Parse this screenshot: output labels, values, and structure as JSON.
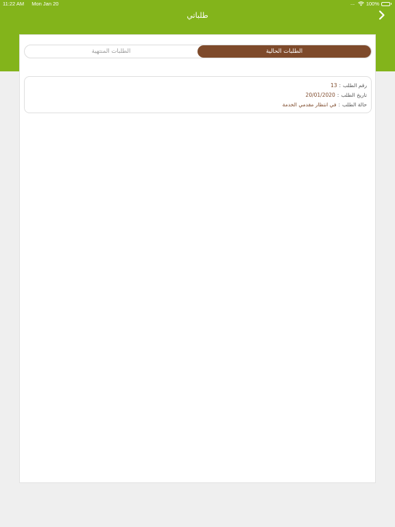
{
  "status_bar": {
    "time": "11:22 AM",
    "date": "Mon Jan 20",
    "battery": "100%",
    "signal_dots": "....."
  },
  "header": {
    "title": "طلباتي",
    "back_icon": "chevron-right-icon",
    "color": "#83b41b"
  },
  "tabs": {
    "current_label": "الطلبات الحالية",
    "finished_label": "الطلبات المنتهية",
    "active": "current",
    "active_color": "#7e4a2b"
  },
  "orders": [
    {
      "number_label": "رقم الطلب",
      "number_value": "13",
      "date_label": "تاريخ الطلب",
      "date_value": "20/01/2020",
      "status_label": "حالة الطلب",
      "status_value": "في انتظار مقدمي الخدمة"
    }
  ]
}
